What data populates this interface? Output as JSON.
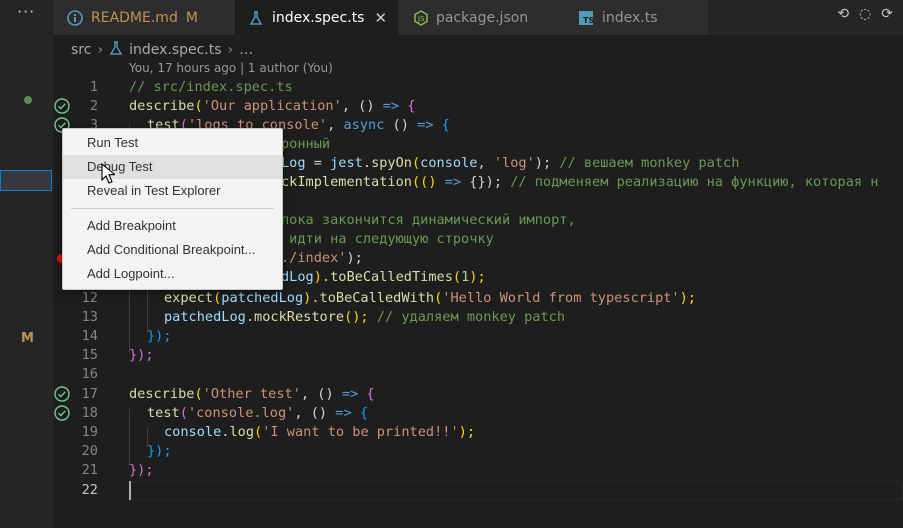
{
  "tabs": [
    {
      "label": "README.md",
      "modified": "M",
      "icon": "info-icon"
    },
    {
      "label": "index.spec.ts",
      "close": "✕",
      "icon": "flask-icon"
    },
    {
      "label": "package.json",
      "icon": "nodejs-icon"
    },
    {
      "label": "index.ts",
      "icon": "typescript-icon"
    }
  ],
  "sidebar": {
    "more": "···",
    "modified_badge": "M"
  },
  "breadcrumb": {
    "folder": "src",
    "file": "index.spec.ts",
    "more": "…"
  },
  "blame": "You, 17 hours ago | 1 author (You)",
  "line_numbers": [
    "1",
    "2",
    "3",
    "",
    "",
    "",
    "",
    "",
    "",
    "",
    "",
    "12",
    "13",
    "14",
    "15",
    "16",
    "17",
    "18",
    "19",
    "20",
    "21",
    "22"
  ],
  "code": {
    "l1": "// src/index.spec.ts",
    "l2a": "describe",
    "l2b": "(",
    "l2c": "'Our application'",
    "l2d": ", () ",
    "l2e": "=>",
    "l2f": " {",
    "l3a": "test",
    "l3b": "(",
    "l3c": "'logs to console'",
    "l3d": ", ",
    "l3e": "async",
    "l3f": " () ",
    "l3g": "=>",
    "l3h": " {",
    "l4": "ронный",
    "l5a": "Log",
    "l5b": " = ",
    "l5c": "jest",
    "l5d": ".",
    "l5e": "spyOn",
    "l5f": "(",
    "l5g": "console",
    "l5h": ", ",
    "l5i": "'log'",
    "l5j": "); ",
    "l5k": "// вешаем monkey patch",
    "l6a": "ckImplementation",
    "l6b": "(() ",
    "l6c": "=>",
    "l6d": " {}); ",
    "l6e": "// подменяем реализацию на функцию, которая н",
    "l8": "пока закончится динамический импорт,",
    "l9": " идти на следующую строчку",
    "l10a": "./index'",
    "l10b": ");",
    "l11a": "dLog",
    "l11b": ").",
    "l11c": "toBeCalledTimes",
    "l11d": "(",
    "l11e": "1",
    "l11f": ");",
    "l12a": "expect",
    "l12b": "(",
    "l12c": "patchedLog",
    "l12d": ").",
    "l12e": "toBeCalledWith",
    "l12f": "(",
    "l12g": "'Hello World from typescript'",
    "l12h": ");",
    "l13a": "patchedLog",
    "l13b": ".",
    "l13c": "mockRestore",
    "l13d": "(); ",
    "l13e": "// удаляем monkey patch",
    "l14": "});",
    "l15": "});",
    "l17a": "describe",
    "l17b": "(",
    "l17c": "'Other test'",
    "l17d": ", () ",
    "l17e": "=>",
    "l17f": " {",
    "l18a": "test",
    "l18b": "(",
    "l18c": "'console.log'",
    "l18d": ", () ",
    "l18e": "=>",
    "l18f": " {",
    "l19a": "console",
    "l19b": ".",
    "l19c": "log",
    "l19d": "(",
    "l19e": "'I want to be printed!!'",
    "l19f": ");",
    "l20": "});",
    "l21": "});"
  },
  "context_menu": {
    "run_test": "Run Test",
    "debug_test": "Debug Test",
    "reveal": "Reveal in Test Explorer",
    "add_breakpoint": "Add Breakpoint",
    "add_conditional": "Add Conditional Breakpoint...",
    "add_logpoint": "Add Logpoint..."
  },
  "colors": {
    "accent": "#007fd4",
    "pass": "#73c991",
    "breakpoint": "#e51400"
  }
}
